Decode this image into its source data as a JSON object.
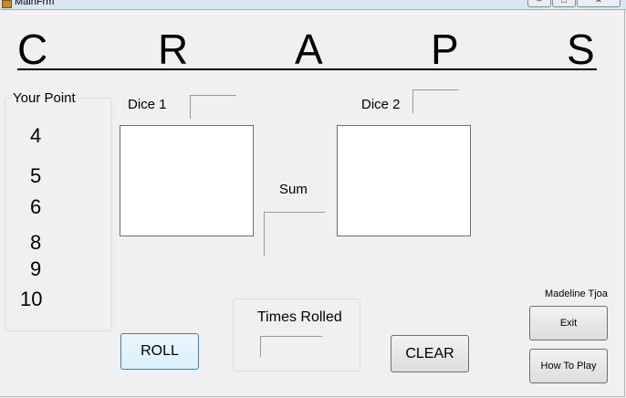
{
  "window": {
    "title": "MainFrm"
  },
  "title_letters": [
    "C",
    "R",
    "A",
    "P",
    "S"
  ],
  "your_point": {
    "label": "Your Point",
    "numbers": [
      "4",
      "5",
      "6",
      "8",
      "9",
      "10"
    ]
  },
  "dice1": {
    "label": "Dice 1",
    "value": ""
  },
  "dice2": {
    "label": "Dice 2",
    "value": ""
  },
  "sum": {
    "label": "Sum",
    "value": ""
  },
  "times_rolled": {
    "label": "Times Rolled",
    "value": ""
  },
  "buttons": {
    "roll": "ROLL",
    "clear": "CLEAR",
    "exit": "Exit",
    "how_to_play": "How To Play"
  },
  "author": "Madeline Tjoa"
}
